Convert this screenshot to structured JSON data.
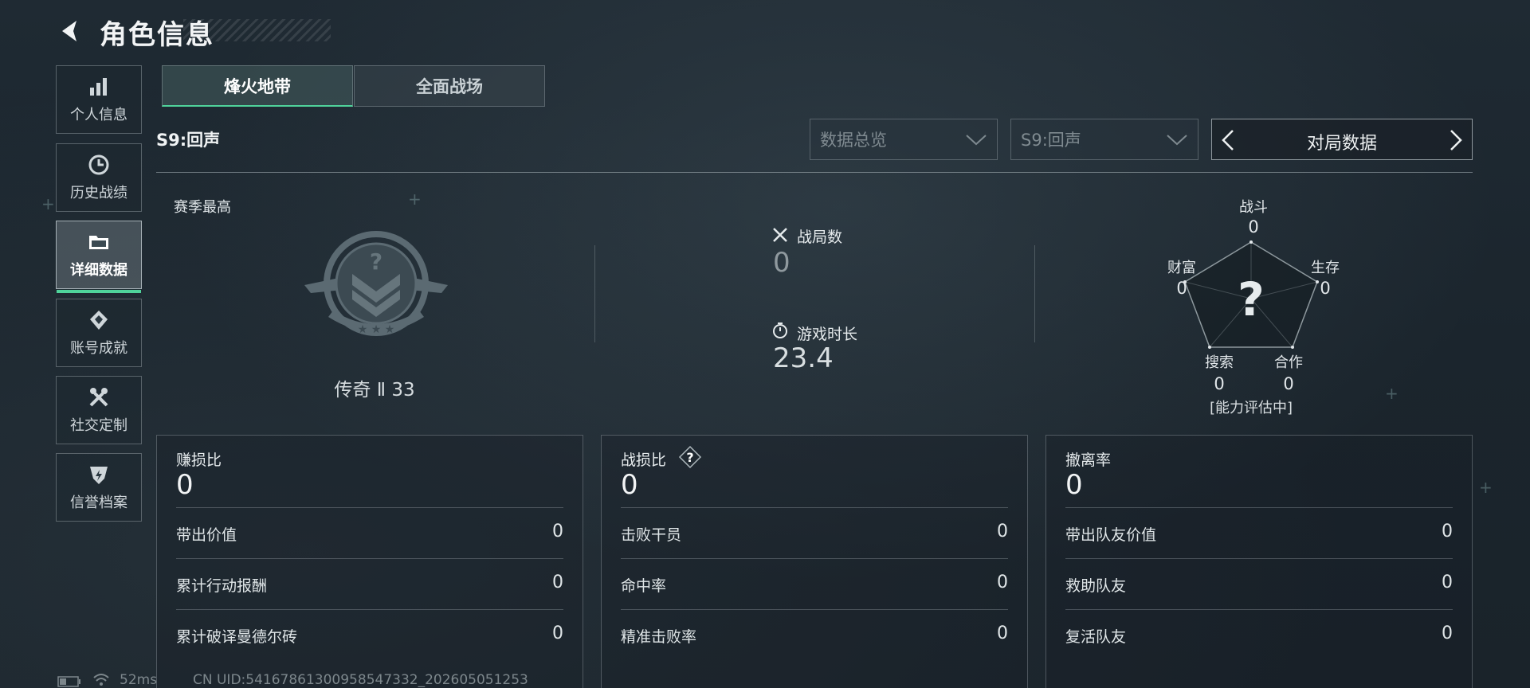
{
  "header": {
    "title": "角色信息"
  },
  "sidebar": {
    "items": [
      {
        "label": "个人信息",
        "icon": "bar-chart-icon"
      },
      {
        "label": "历史战绩",
        "icon": "history-icon"
      },
      {
        "label": "详细数据",
        "icon": "folder-icon",
        "active": true
      },
      {
        "label": "账号成就",
        "icon": "achievement-icon"
      },
      {
        "label": "社交定制",
        "icon": "tools-icon"
      },
      {
        "label": "信誉档案",
        "icon": "shield-icon"
      }
    ]
  },
  "tabs": [
    {
      "label": "烽火地带",
      "active": true
    },
    {
      "label": "全面战场",
      "active": false
    }
  ],
  "season_label": "S9:回声",
  "filters": {
    "data_type": "数据总览",
    "season": "S9:回声",
    "mode_switch": "对局数据"
  },
  "rank": {
    "section_label": "赛季最高",
    "rank_text": "传奇 Ⅱ 33"
  },
  "summary": {
    "matches_label": "战局数",
    "matches_value": "0",
    "playtime_label": "游戏时长",
    "playtime_value": "23.4"
  },
  "radar": {
    "center_mark": "?",
    "status": "[能力评估中]",
    "axes": [
      {
        "label": "战斗",
        "value": "0"
      },
      {
        "label": "生存",
        "value": "0"
      },
      {
        "label": "合作",
        "value": "0"
      },
      {
        "label": "搜索",
        "value": "0"
      },
      {
        "label": "财富",
        "value": "0"
      }
    ]
  },
  "panels": [
    {
      "title": "赚损比",
      "value": "0",
      "rows": [
        {
          "label": "带出价值",
          "value": "0"
        },
        {
          "label": "累计行动报酬",
          "value": "0"
        },
        {
          "label": "累计破译曼德尔砖",
          "value": "0"
        }
      ]
    },
    {
      "title": "战损比",
      "value": "0",
      "help_mark": "?",
      "rows": [
        {
          "label": "击败干员",
          "value": "0"
        },
        {
          "label": "命中率",
          "value": "0"
        },
        {
          "label": "精准击败率",
          "value": "0"
        }
      ]
    },
    {
      "title": "撤离率",
      "value": "0",
      "rows": [
        {
          "label": "带出队友价值",
          "value": "0"
        },
        {
          "label": "救助队友",
          "value": "0"
        },
        {
          "label": "复活队友",
          "value": "0"
        }
      ]
    }
  ],
  "footer": {
    "latency": "52ms",
    "uid": "CN UID:54167861300958547332_202605051253"
  },
  "colors": {
    "accent": "#4fd39b",
    "background": "#1c262e"
  }
}
